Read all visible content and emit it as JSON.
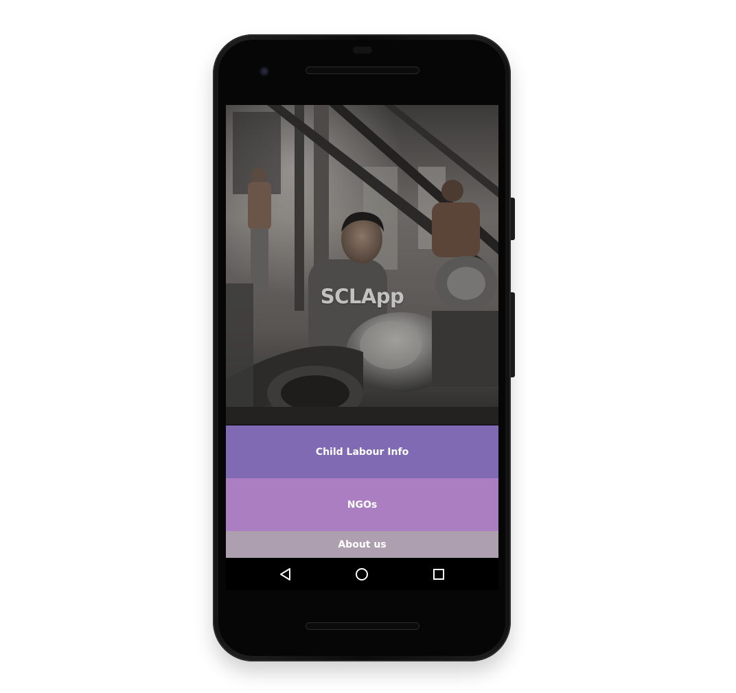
{
  "app": {
    "title": "SCLApp"
  },
  "menu": {
    "items": [
      {
        "label": "Child Labour Info",
        "color": "#7f6ab3"
      },
      {
        "label": "NGOs",
        "color": "#ab7dc1"
      },
      {
        "label": "About us",
        "color": "#ad9fb0"
      }
    ]
  },
  "navbar": {
    "icons": [
      "back-icon",
      "home-icon",
      "recents-icon"
    ]
  },
  "hero": {
    "image": "photo of a child working at factory machinery"
  }
}
